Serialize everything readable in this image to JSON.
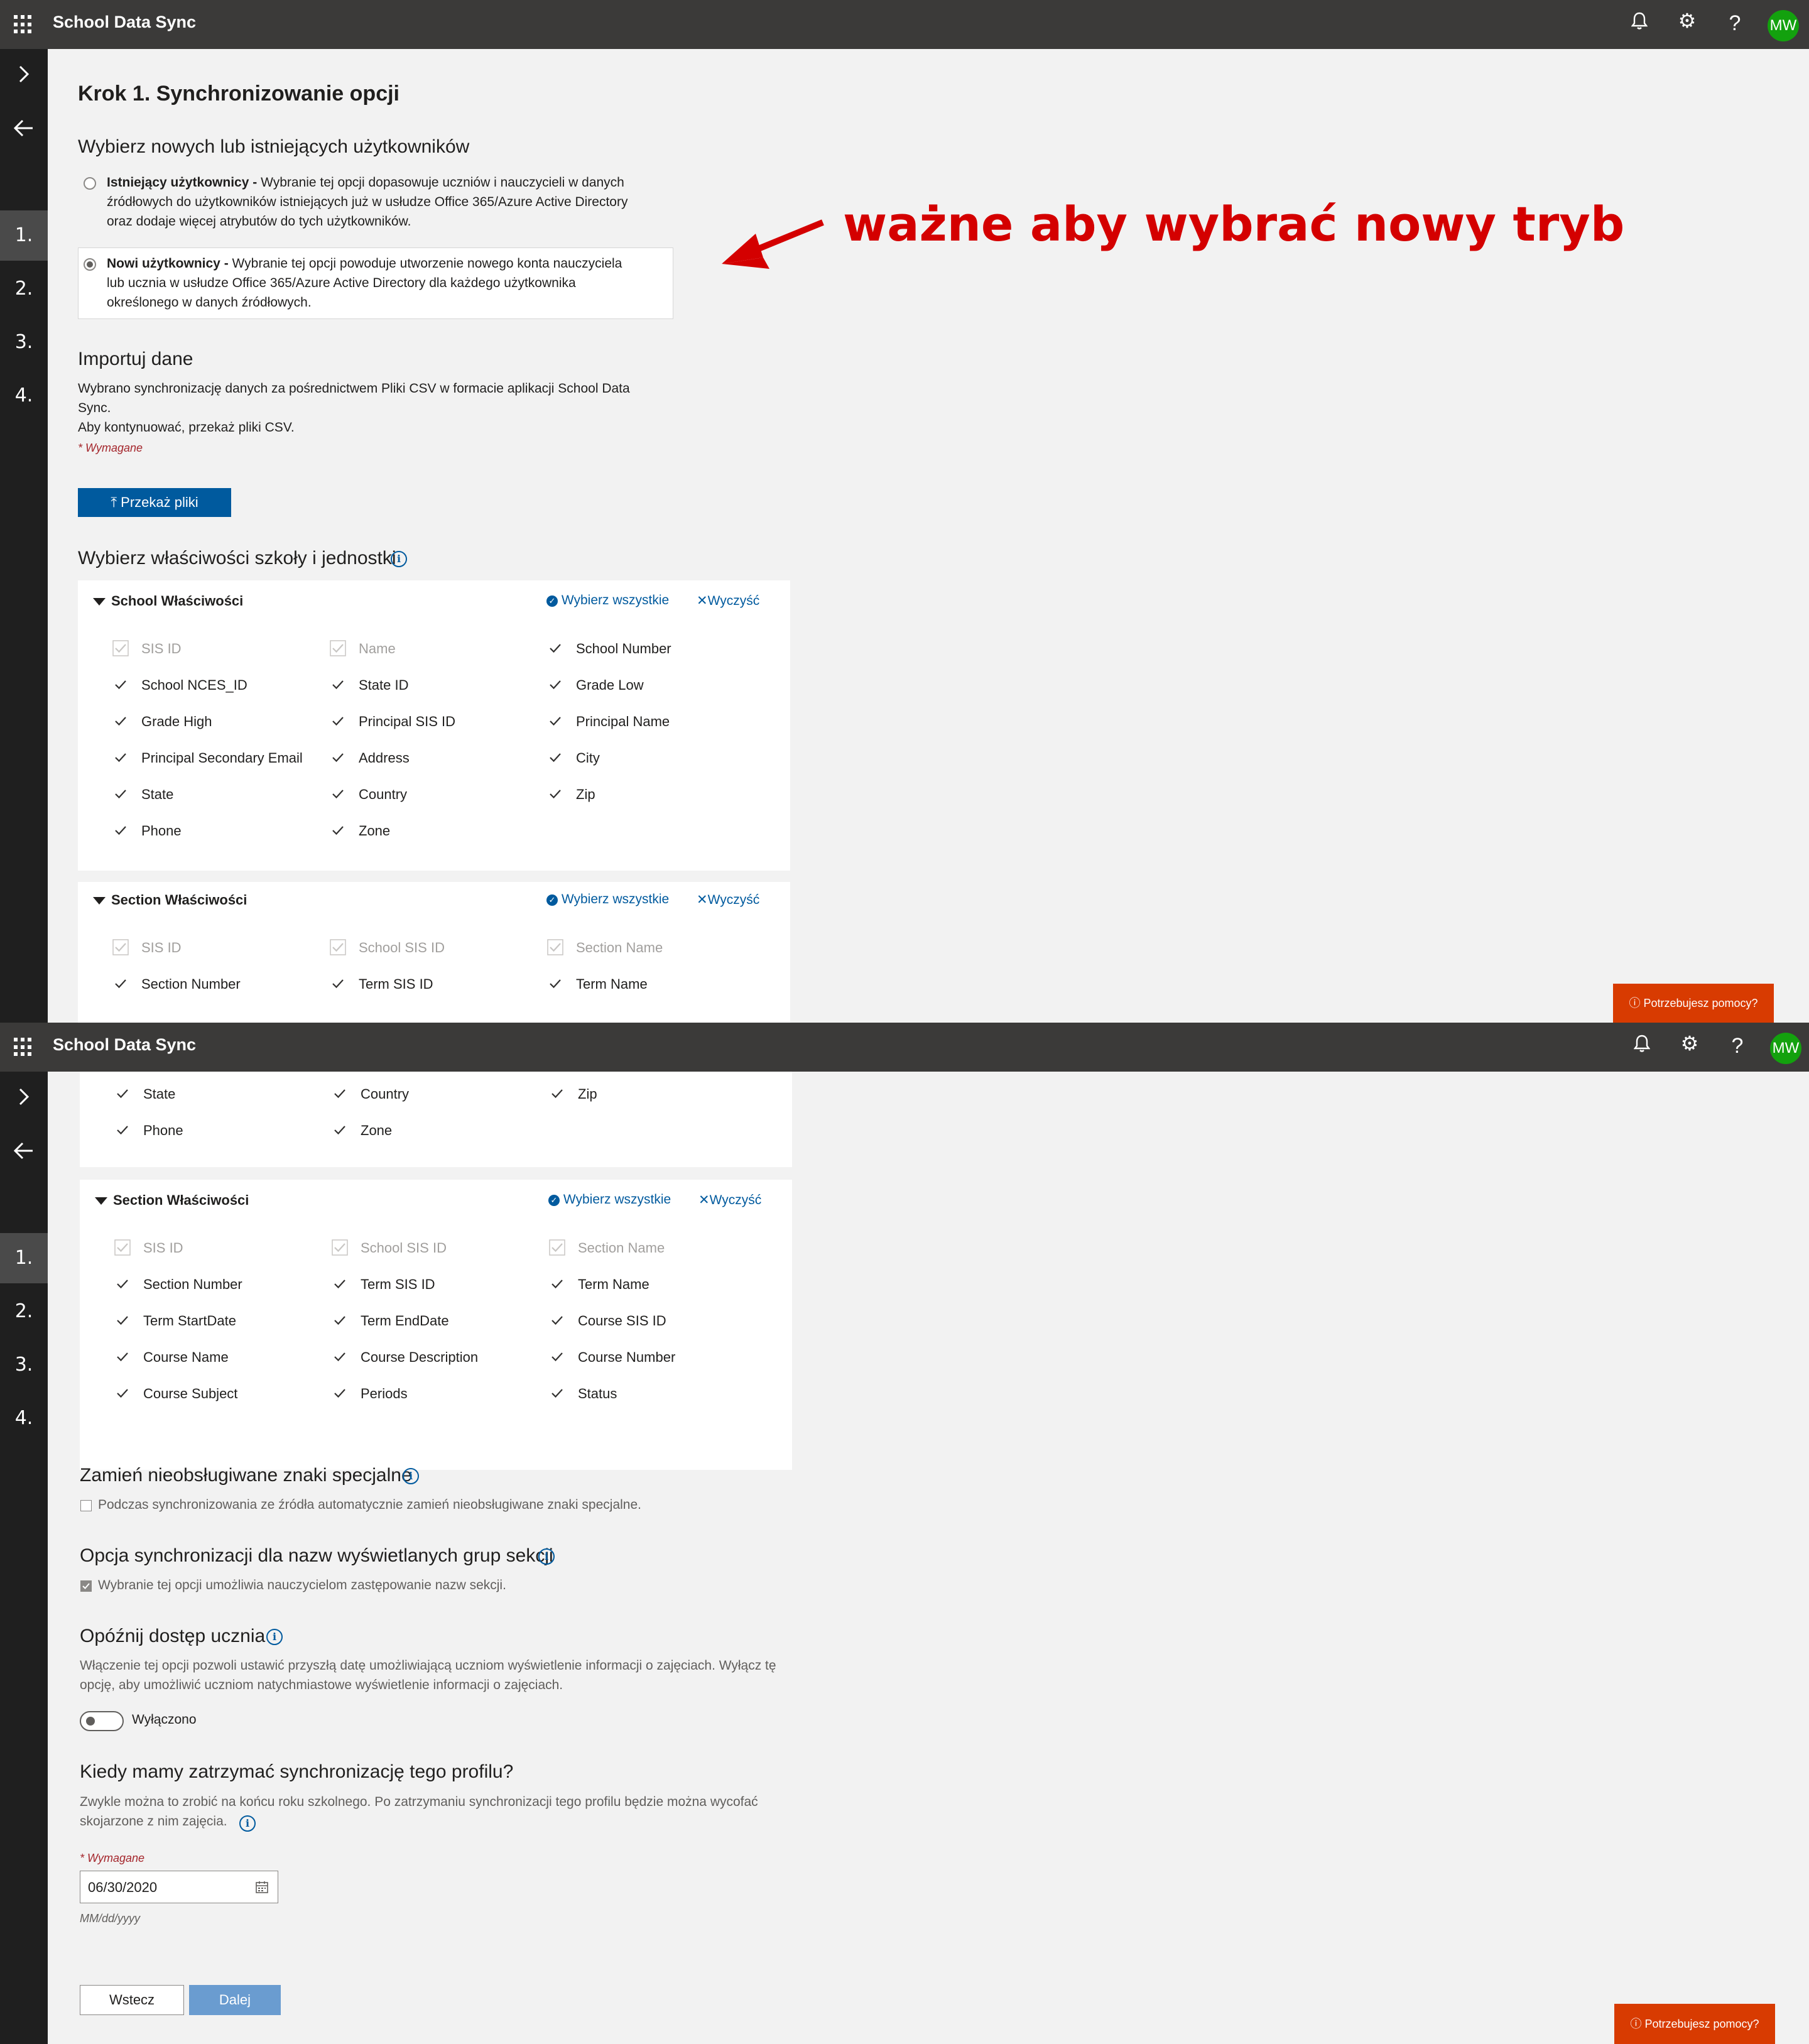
{
  "app": {
    "title": "School Data Sync",
    "avatar": "MW",
    "icons": [
      "waffle-icon",
      "bell-icon",
      "gear-icon",
      "help-icon"
    ]
  },
  "rail": {
    "steps": [
      "1.",
      "2.",
      "3.",
      "4."
    ],
    "active_step": "1."
  },
  "page": {
    "title": "Krok 1. Synchronizowanie opcji"
  },
  "users": {
    "heading": "Wybierz nowych lub istniejących użytkowników",
    "existing_bold": "Istniejący użytkownicy -",
    "existing_desc_l1": " Wybranie tej opcji dopasowuje uczniów i nauczycieli w danych",
    "existing_desc_l2": "źródłowych do użytkowników istniejących już w usłudze Office 365/Azure Active Directory",
    "existing_desc_l3": "oraz dodaje więcej atrybutów do tych użytkowników.",
    "new_bold": "Nowi użytkownicy -",
    "new_desc_l1": " Wybranie tej opcji powoduje utworzenie nowego konta nauczyciela",
    "new_desc_l2": "lub ucznia w usłudze Office 365/Azure Active Directory dla każdego użytkownika",
    "new_desc_l3": "określonego w danych źródłowych.",
    "selected": "new"
  },
  "annotation": {
    "text": "ważne aby wybrać nowy tryb",
    "color": "#d40000"
  },
  "import": {
    "heading": "Importuj dane",
    "line1": "Wybrano synchronizację danych za pośrednictwem Pliki CSV w formacie aplikacji School Data",
    "line2": "Sync.",
    "line3": "Aby kontynuować, przekaż pliki CSV.",
    "required": "* Wymagane",
    "upload_button": "Przekaż pliki"
  },
  "properties": {
    "heading": "Wybierz właściwości szkoły i jednostki",
    "select_all": "Wybierz wszystkie",
    "clear": "Wyczyść"
  },
  "school_card": {
    "title": "School Właściwości",
    "rows": [
      [
        {
          "label": "SIS ID",
          "disabled": true
        },
        {
          "label": "Name",
          "disabled": true
        },
        {
          "label": "School Number",
          "disabled": false
        }
      ],
      [
        {
          "label": "School NCES_ID",
          "disabled": false
        },
        {
          "label": "State ID",
          "disabled": false
        },
        {
          "label": "Grade Low",
          "disabled": false
        }
      ],
      [
        {
          "label": "Grade High",
          "disabled": false
        },
        {
          "label": "Principal SIS ID",
          "disabled": false
        },
        {
          "label": "Principal Name",
          "disabled": false
        }
      ],
      [
        {
          "label": "Principal Secondary Email",
          "disabled": false
        },
        {
          "label": "Address",
          "disabled": false
        },
        {
          "label": "City",
          "disabled": false
        }
      ],
      [
        {
          "label": "State",
          "disabled": false
        },
        {
          "label": "Country",
          "disabled": false
        },
        {
          "label": "Zip",
          "disabled": false
        }
      ],
      [
        {
          "label": "Phone",
          "disabled": false
        },
        {
          "label": "Zone",
          "disabled": false
        }
      ]
    ]
  },
  "section_card": {
    "title": "Section Właściwości",
    "rows": [
      [
        {
          "label": "SIS ID",
          "disabled": true
        },
        {
          "label": "School SIS ID",
          "disabled": true
        },
        {
          "label": "Section Name",
          "disabled": true
        }
      ],
      [
        {
          "label": "Section Number",
          "disabled": false
        },
        {
          "label": "Term SIS ID",
          "disabled": false
        },
        {
          "label": "Term Name",
          "disabled": false
        }
      ],
      [
        {
          "label": "Term StartDate",
          "disabled": false
        },
        {
          "label": "Term EndDate",
          "disabled": false
        },
        {
          "label": "Course SIS ID",
          "disabled": false
        }
      ],
      [
        {
          "label": "Course Name",
          "disabled": false
        },
        {
          "label": "Course Description",
          "disabled": false
        },
        {
          "label": "Course Number",
          "disabled": false
        }
      ],
      [
        {
          "label": "Course Subject",
          "disabled": false
        },
        {
          "label": "Periods",
          "disabled": false
        },
        {
          "label": "Status",
          "disabled": false
        }
      ]
    ]
  },
  "special_chars": {
    "heading": "Zamień nieobsługiwane znaki specjalne",
    "option": "Podczas synchronizowania ze źródła automatycznie zamień nieobsługiwane znaki specjalne.",
    "checked": false
  },
  "group_names": {
    "heading": "Opcja synchronizacji dla nazw wyświetlanych grup sekcji",
    "option": "Wybranie tej opcji umożliwia nauczycielom zastępowanie nazw sekcji.",
    "checked": true
  },
  "delay": {
    "heading": "Opóźnij dostęp ucznia",
    "line1": "Włączenie tej opcji pozwoli ustawić przyszłą datę umożliwiającą uczniom wyświetlenie informacji o zajęciach. Wyłącz tę",
    "line2": "opcję, aby umożliwić uczniom natychmiastowe wyświetlenie informacji o zajęciach.",
    "toggle_label": "Wyłączono",
    "enabled": false
  },
  "stop_sync": {
    "heading": "Kiedy mamy zatrzymać synchronizację tego profilu?",
    "line1": "Zwykle można to zrobić na końcu roku szkolnego. Po zatrzymaniu synchronizacji tego profilu będzie można wycofać",
    "line2": "skojarzone z nim zajęcia.",
    "required": "* Wymagane",
    "date_value": "06/30/2020",
    "date_format": "MM/dd/yyyy"
  },
  "nav": {
    "back": "Wstecz",
    "next": "Dalej"
  },
  "help": {
    "label": "Potrzebujesz pomocy?"
  }
}
